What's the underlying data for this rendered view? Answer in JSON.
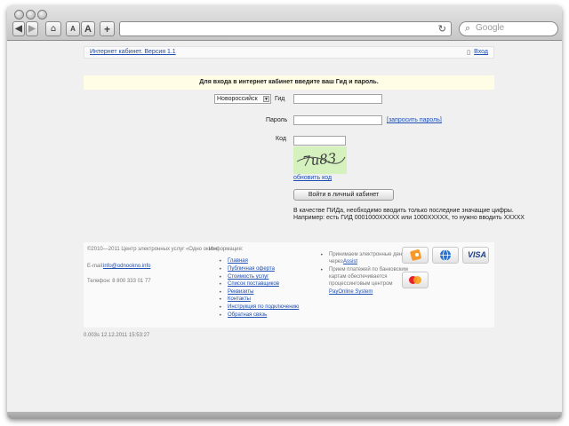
{
  "browser": {
    "search_placeholder": "Google",
    "font_smaller_label": "A",
    "font_larger_label": "A",
    "add_label": "+"
  },
  "page": {
    "top_link": "Интернет кабинет. Версия 1.1",
    "login_link": "Вход",
    "banner": "Для входа в интернет кабинет введите ваш Гид и пароль.",
    "region_selected": "Новороссийск",
    "gid_label": "Гид",
    "gid_value": "",
    "password_label": "Пароль",
    "password_value": "",
    "forgot_link": "[запросить пароль]",
    "code_label": "Код",
    "code_value": "",
    "captcha_text": "7u83",
    "refresh_link": "обновить код",
    "submit_label": "Войти в личный кабинет",
    "note_line1": "В качестве ПИДа, необходимо вводить только последние значащие цифры.",
    "note_line2": "Например: есть ГИД 0001000XXXXX или 1000XXXXX, то нужно вводить XXXXX"
  },
  "footer": {
    "copyright": "©2010—2011 Центр электронных услуг «Одно окно»",
    "email_label": "E-mail:",
    "email": "info@odnookno.info",
    "phone": "Телефон: 8 800 333 01 77",
    "info_heading": "Информация:",
    "links": [
      "Главная",
      "Публичная оферта",
      "Стоимость услуг",
      "Список поставщиков",
      "Реквизиты",
      "Контакты",
      "Инструкция по подключению",
      "Обратная связь"
    ],
    "pay_note1_lines": [
      "Принимаем электронные деньги",
      "через"
    ],
    "pay_note1_link": "Assist",
    "pay_note2_lines": [
      "Прием платежей по банковским",
      "картам обеспечивается",
      "процессинговым центром"
    ],
    "pay_note2_link": "PayOnline System",
    "visa_label": "VISA"
  },
  "status_line": "0.003s   12.12.2011 15:53:27",
  "colors": {
    "link": "#1f4fb3",
    "banner_bg": "#fffde6",
    "captcha_bg": "#d4f1be"
  }
}
